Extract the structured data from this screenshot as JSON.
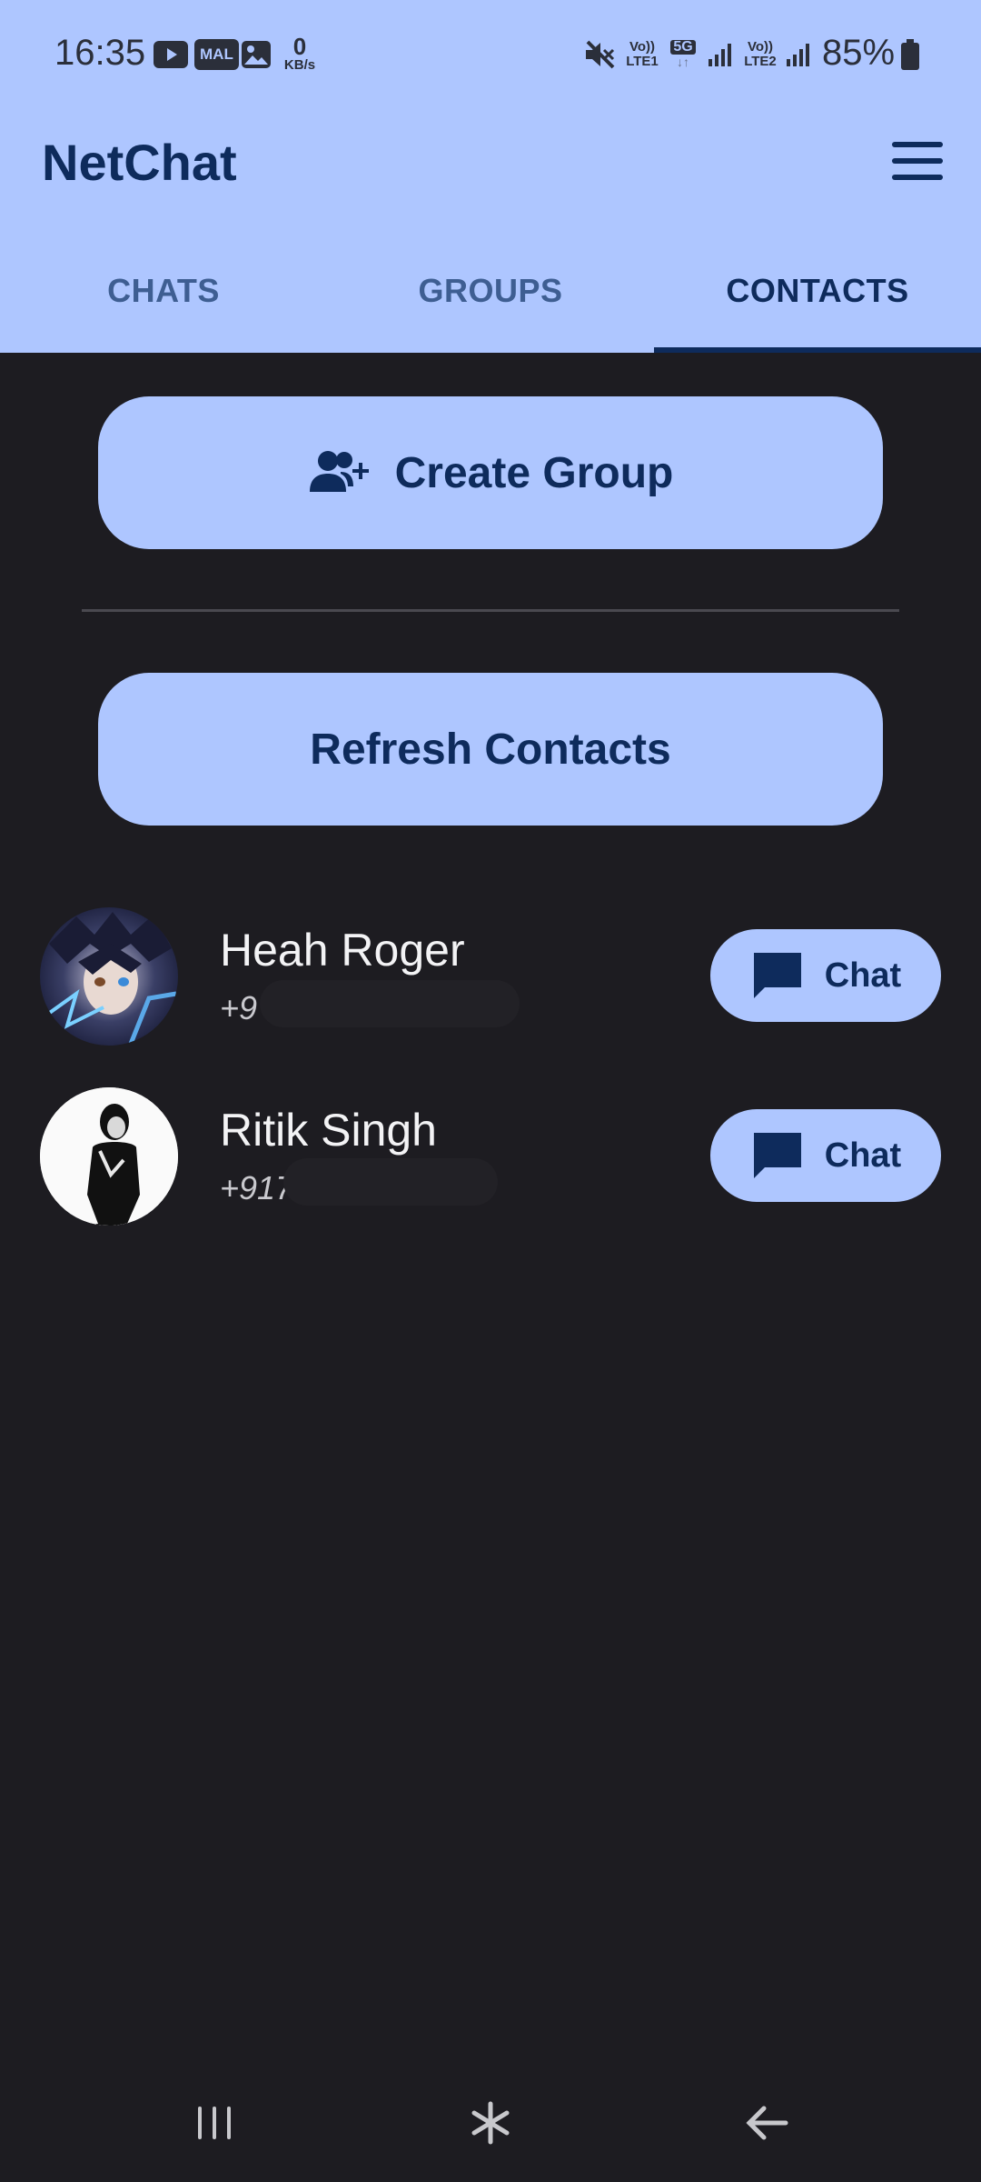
{
  "status_bar": {
    "time": "16:35",
    "yt_icon": "youtube-icon",
    "mal_label": "MAL",
    "kbs_value": "0",
    "kbs_unit": "KB/s",
    "volte1": "Vo))",
    "lte1": "LTE1",
    "net5g": "5G",
    "volte2": "Vo))",
    "lte2": "LTE2",
    "battery": "85%"
  },
  "app": {
    "title": "NetChat",
    "menu_icon": "hamburger-menu-icon"
  },
  "tabs": [
    {
      "label": "CHATS",
      "active": false
    },
    {
      "label": "GROUPS",
      "active": false
    },
    {
      "label": "CONTACTS",
      "active": true
    }
  ],
  "actions": {
    "create_group_label": "Create Group",
    "create_group_icon": "add-group-icon",
    "refresh_label": "Refresh Contacts"
  },
  "contacts": [
    {
      "name": "Heah Roger",
      "phone_visible": "+9",
      "chat_label": "Chat"
    },
    {
      "name": "Ritik Singh",
      "phone_visible": "+917",
      "chat_label": "Chat"
    }
  ],
  "colors": {
    "accent": "#aec6ff",
    "on_accent": "#0e2b5c",
    "background": "#1d1c21"
  }
}
